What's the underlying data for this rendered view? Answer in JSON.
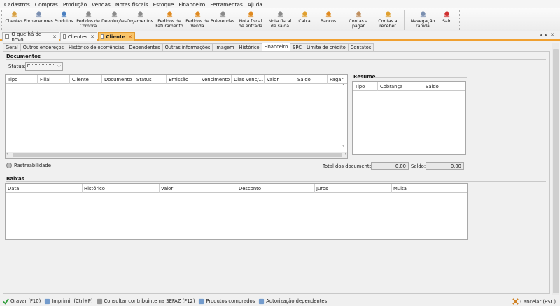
{
  "menu": [
    "Cadastros",
    "Compras",
    "Produção",
    "Vendas",
    "Notas fiscais",
    "Estoque",
    "Financeiro",
    "Ferramentas",
    "Ajuda"
  ],
  "toolbar": [
    {
      "label": "Clientes",
      "icon": "clients-icon",
      "color": "#d8a040"
    },
    {
      "label": "Fornecedores",
      "icon": "suppliers-icon",
      "color": "#7a8fb0"
    },
    {
      "label": "Produtos",
      "icon": "products-icon",
      "color": "#4a7fc0"
    },
    {
      "label": "Pedidos de\nCompra",
      "icon": "purchase-order-icon",
      "color": "#8a8a8a"
    },
    {
      "label": "Devoluções",
      "icon": "returns-icon",
      "color": "#8a8a8a"
    },
    {
      "label": "Orçamentos",
      "icon": "quotes-icon",
      "color": "#8a8a8a"
    },
    {
      "label": "Pedidos de\nFaturamento",
      "icon": "billing-order-icon",
      "color": "#e08a20"
    },
    {
      "label": "Pedidos de\nVenda",
      "icon": "sales-order-icon",
      "color": "#e08a20"
    },
    {
      "label": "Pré-vendas",
      "icon": "presales-icon",
      "color": "#8a8a8a"
    },
    {
      "label": "Nota fiscal\nde entrada",
      "icon": "invoice-in-icon",
      "color": "#e08a20"
    },
    {
      "label": "Nota fiscal\nde saída",
      "icon": "invoice-out-icon",
      "color": "#8a8a8a"
    },
    {
      "label": "Caixa",
      "icon": "cash-register-icon",
      "color": "#e0a030"
    },
    {
      "label": "Bancos",
      "icon": "bank-icon",
      "color": "#e08a20"
    },
    {
      "label": "Contas a\npagar",
      "icon": "accounts-payable-icon",
      "color": "#c09060"
    },
    {
      "label": "Contas a\nreceber",
      "icon": "accounts-receivable-icon",
      "color": "#e0a030"
    },
    {
      "label": "Navegação\nrápida",
      "icon": "quick-nav-icon",
      "color": "#7a8fb0"
    },
    {
      "label": "Sair",
      "icon": "exit-icon",
      "color": "#d03030"
    }
  ],
  "doc_tabs": [
    {
      "label": "O que há de novo",
      "active": false
    },
    {
      "label": "Clientes",
      "active": false
    },
    {
      "label": "Cliente",
      "active": true
    }
  ],
  "sub_tabs": [
    {
      "label": "Geral",
      "active": false
    },
    {
      "label": "Outros endereços",
      "active": false
    },
    {
      "label": "Histórico de ocorrências",
      "active": false
    },
    {
      "label": "Dependentes",
      "active": false
    },
    {
      "label": "Outras informações",
      "active": false
    },
    {
      "label": "Imagem",
      "active": false
    },
    {
      "label": "Histórico",
      "active": false
    },
    {
      "label": "Financeiro",
      "active": true
    },
    {
      "label": "SPC",
      "active": false
    },
    {
      "label": "Limite de crédito",
      "active": false
    },
    {
      "label": "Contatos",
      "active": false
    }
  ],
  "documentos": {
    "title": "Documentos",
    "status_label": "Status:",
    "columns": [
      "Tipo",
      "Filial",
      "Cliente",
      "Documento",
      "Status",
      "Emissão",
      "Vencimento",
      "Dias Venc/...",
      "Valor",
      "Saldo",
      "Pagar"
    ]
  },
  "resumo": {
    "title": "Resumo",
    "columns": [
      "Tipo",
      "Cobrança",
      "Saldo"
    ]
  },
  "rastreabilidade": "Rastreabilidade",
  "totals": {
    "total_label": "Total dos documentos:",
    "total_value": "0,00",
    "saldo_label": "Saldo:",
    "saldo_value": "0,00"
  },
  "baixas": {
    "title": "Baixas",
    "columns": [
      "Data",
      "Histórico",
      "Valor",
      "Desconto",
      "Juros",
      "Multa"
    ]
  },
  "statusbar": [
    {
      "label": "Gravar (F10)",
      "icon": "checkmark-icon"
    },
    {
      "label": "Imprimir (Ctrl+P)",
      "icon": "printer-icon"
    },
    {
      "label": "Consultar contribuinte na SEFAZ (F12)",
      "icon": "person-search-icon"
    },
    {
      "label": "Produtos comprados",
      "icon": "products-list-icon"
    },
    {
      "label": "Autorização dependentes",
      "icon": "authorization-icon"
    }
  ],
  "cancel": {
    "label": "Cancelar (ESC)",
    "icon": "cancel-icon"
  },
  "colors": {
    "accent": "#f0a030",
    "active_tab": "#f9c56a",
    "cancel": "#d08020",
    "save": "#2e9e3a"
  }
}
